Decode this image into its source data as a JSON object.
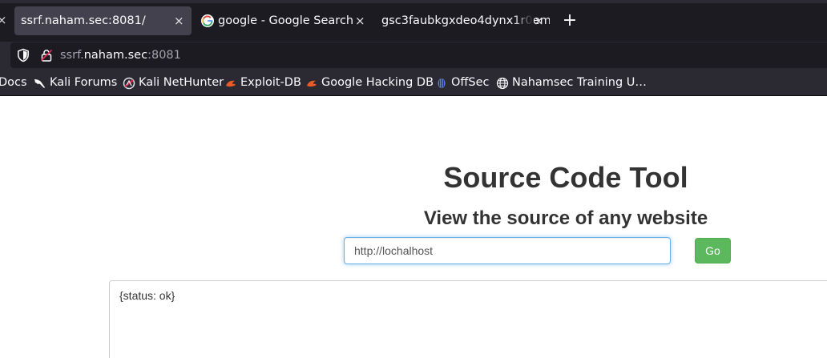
{
  "browser": {
    "tabs": [
      {
        "title": "ssrf.naham.sec:8081/",
        "active": true,
        "close_glyph": "×"
      },
      {
        "title": "google - Google Search",
        "active": false,
        "close_glyph": "×",
        "icon": "google-icon"
      },
      {
        "title": "gsc3faubkgxdeo4dynx1r0em",
        "active": false,
        "close_glyph": "×"
      }
    ],
    "edge_close_glyph": "×",
    "new_tab_glyph": "+",
    "address_bar": {
      "url_prefix": "ssrf.",
      "url_host": "naham.sec",
      "url_suffix": ":8081"
    },
    "bookmarks": [
      {
        "label": "Docs",
        "icon": ""
      },
      {
        "label": "Kali Forums",
        "icon": "kali-dragon-icon"
      },
      {
        "label": "Kali NetHunter",
        "icon": "nethunter-icon"
      },
      {
        "label": "Exploit-DB",
        "icon": "exploit-db-icon"
      },
      {
        "label": "Google Hacking DB",
        "icon": "ghdb-icon"
      },
      {
        "label": "OffSec",
        "icon": "offsec-icon"
      },
      {
        "label": "Nahamsec Training U…",
        "icon": "globe-icon"
      }
    ]
  },
  "page": {
    "title": "Source Code Tool",
    "subtitle": "View the source of any website",
    "url_input_value": "http://lochalhost",
    "go_label": "Go",
    "result_text": "{status: ok}"
  },
  "colors": {
    "tab_strip": "#1c1b22",
    "toolbar": "#2b2a33",
    "active_tab": "#42414d",
    "go_button": "#5cb85c",
    "input_focus": "#66afe9"
  }
}
